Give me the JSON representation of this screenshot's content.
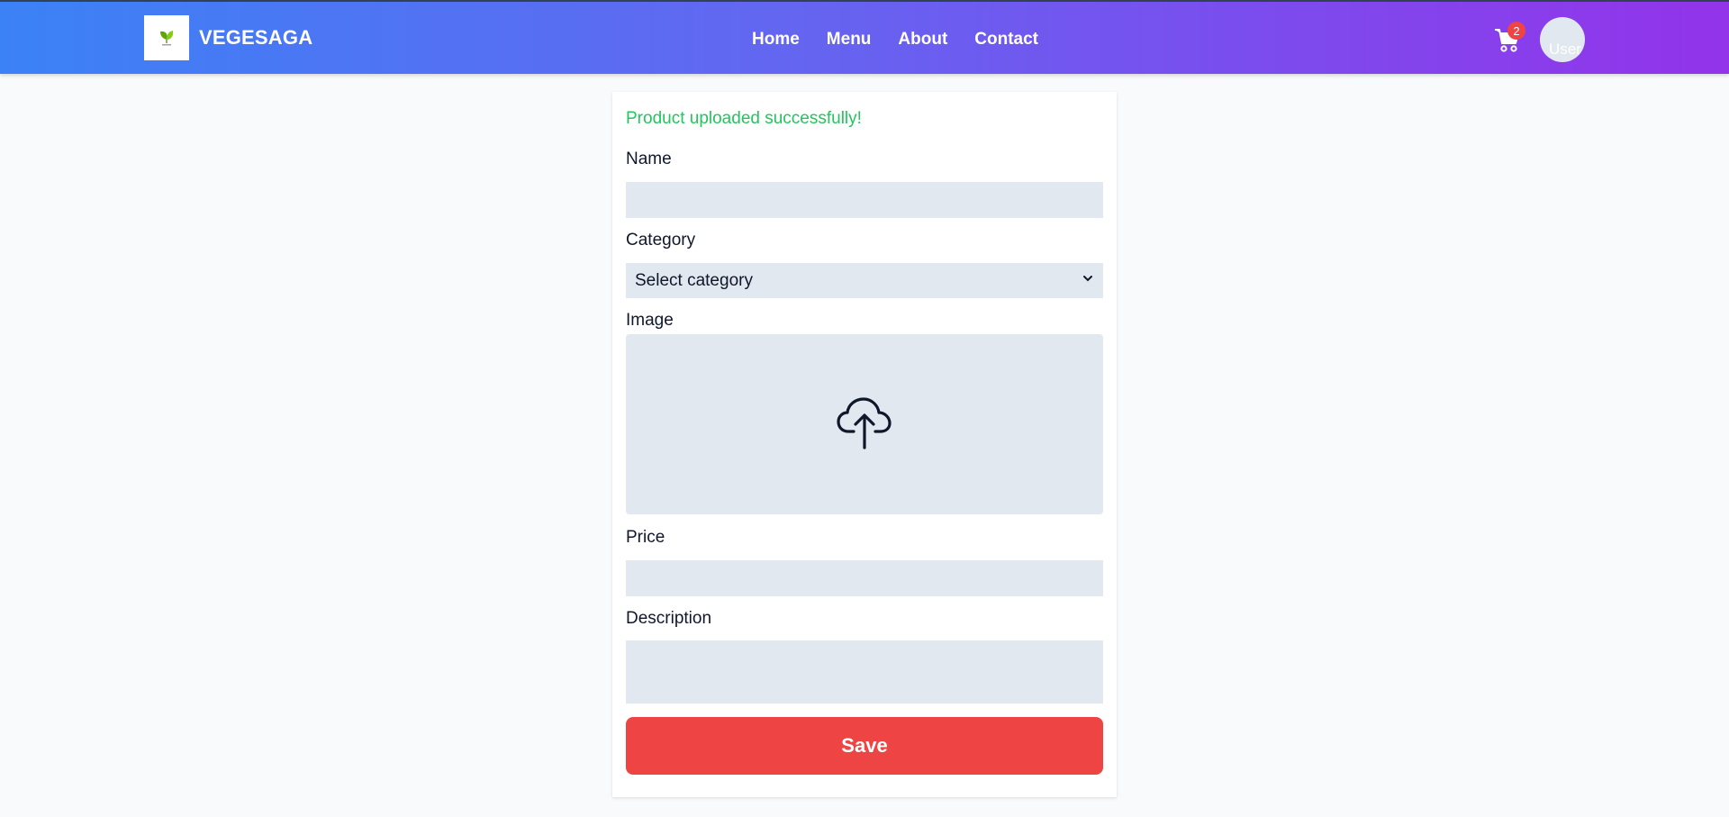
{
  "header": {
    "brand": "VEGESAGA",
    "nav": [
      "Home",
      "Menu",
      "About",
      "Contact"
    ],
    "cart_count": "2",
    "avatar_alt": "User",
    "icons": {
      "logo": "leaf-logo-icon",
      "cart": "cart-icon"
    }
  },
  "form": {
    "success_message": "Product uploaded successfully!",
    "name_label": "Name",
    "name_value": "",
    "category_label": "Category",
    "category_selected": "Select category",
    "image_label": "Image",
    "upload_icon": "cloud-upload-icon",
    "price_label": "Price",
    "price_value": "",
    "description_label": "Description",
    "description_value": "",
    "save_label": "Save"
  },
  "colors": {
    "header_gradient_start": "#3b82f6",
    "header_gradient_end": "#9333ea",
    "success": "#22c55e",
    "save_button": "#ef4444",
    "field_bg": "#e2e8f0",
    "page_bg": "#f8fafc"
  }
}
